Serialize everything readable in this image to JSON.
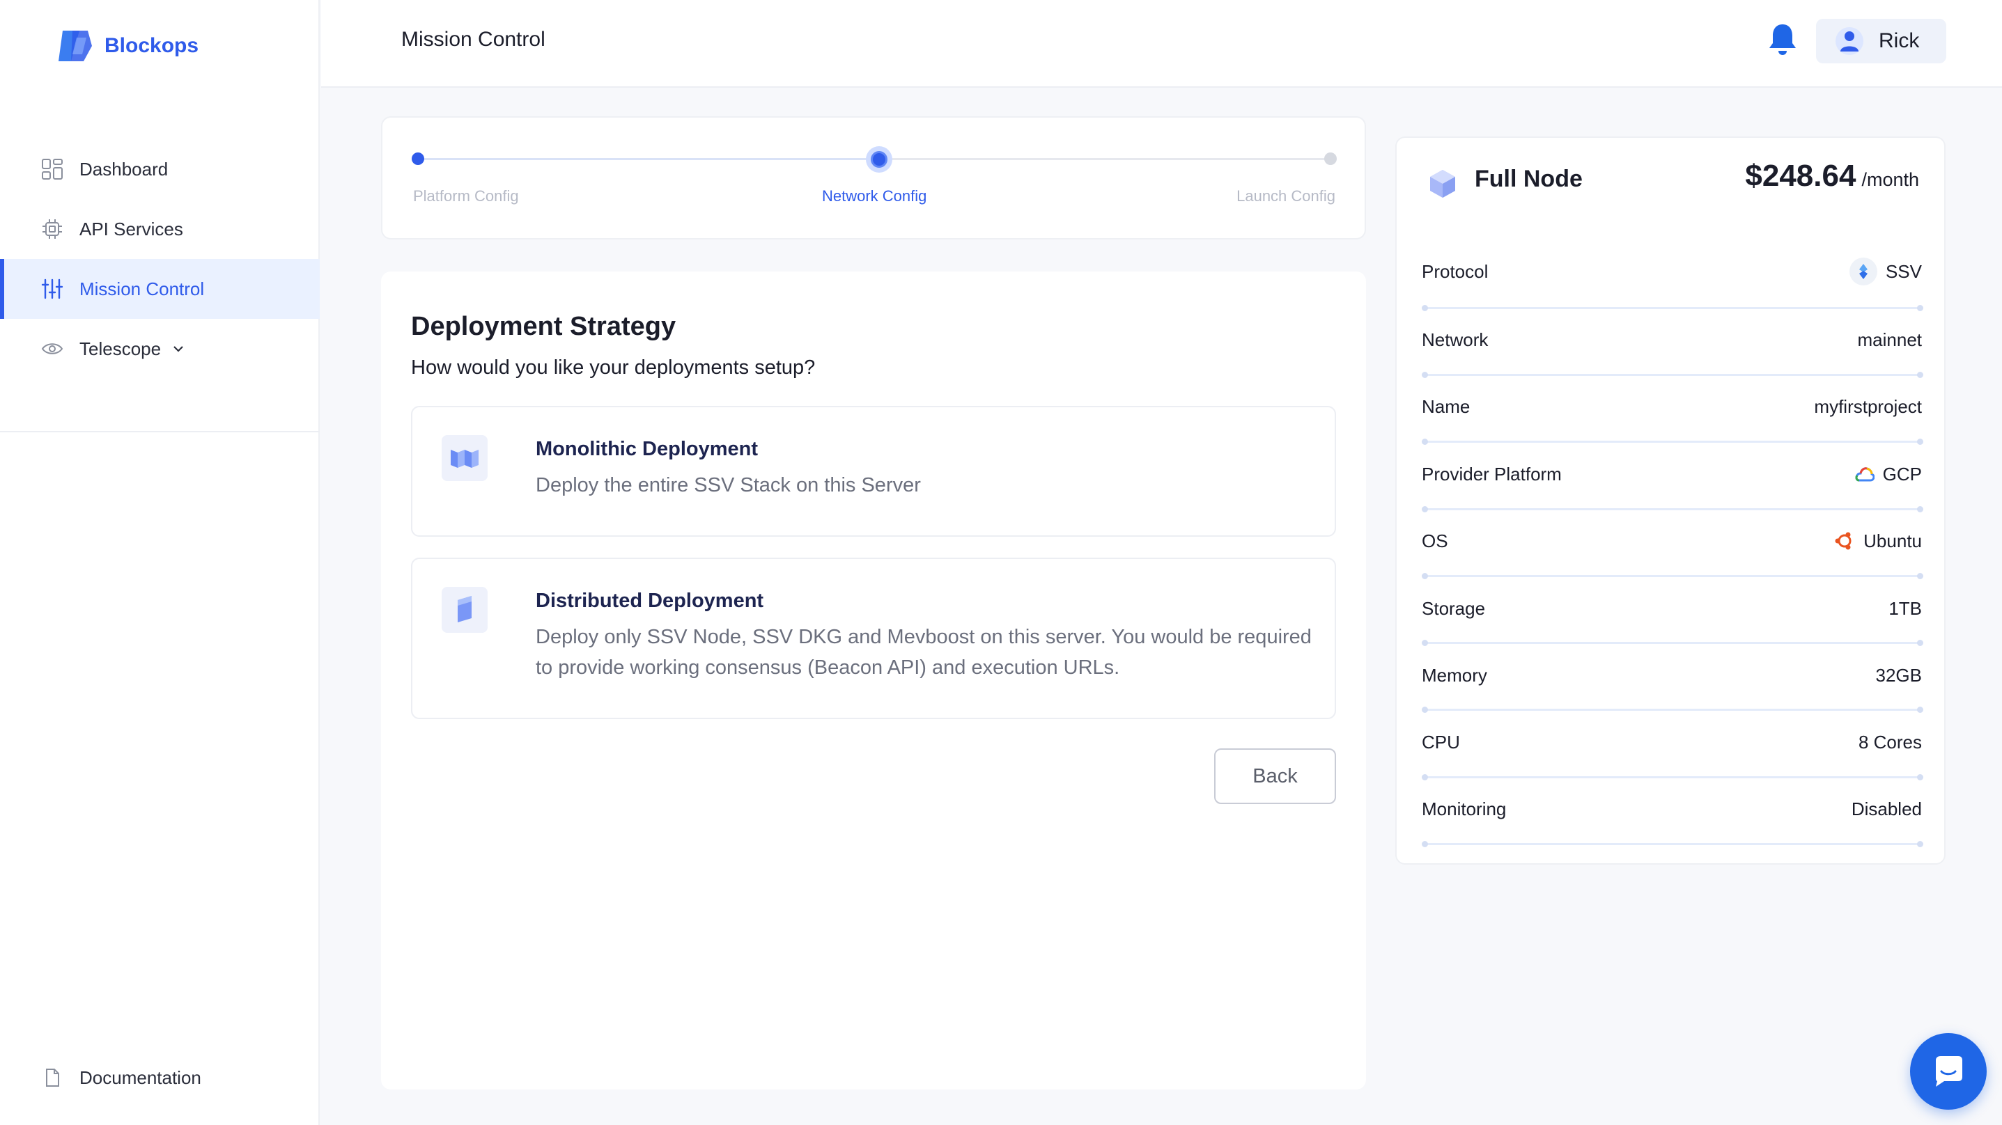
{
  "app": {
    "name": "Blockops"
  },
  "sidebar": {
    "items": [
      {
        "label": "Dashboard",
        "icon": "dashboard-icon"
      },
      {
        "label": "API Services",
        "icon": "chip-icon"
      },
      {
        "label": "Mission Control",
        "icon": "sliders-icon",
        "active": true
      },
      {
        "label": "Telescope",
        "icon": "eye-icon"
      }
    ],
    "footer": {
      "label": "Documentation",
      "icon": "document-icon"
    }
  },
  "header": {
    "title": "Mission Control",
    "user": "Rick"
  },
  "stepper": {
    "steps": [
      {
        "label": "Platform Config",
        "state": "done"
      },
      {
        "label": "Network Config",
        "state": "current"
      },
      {
        "label": "Launch Config",
        "state": "pending"
      }
    ]
  },
  "strategy": {
    "title": "Deployment Strategy",
    "subtitle": "How would you like your deployments setup?",
    "options": [
      {
        "title": "Monolithic Deployment",
        "description": "Deploy the entire SSV Stack on this Server",
        "icon": "monolithic-icon"
      },
      {
        "title": "Distributed Deployment",
        "description": "Deploy only SSV Node, SSV DKG and Mevboost on this server. You would be required to provide working consensus (Beacon API) and execution URLs.",
        "icon": "distributed-icon"
      }
    ],
    "back_label": "Back"
  },
  "summary": {
    "title": "Full Node",
    "price": "$248.64",
    "price_unit": "/month",
    "specs": [
      {
        "key": "Protocol",
        "value": "SSV",
        "icon": "ssv-icon"
      },
      {
        "key": "Network",
        "value": "mainnet"
      },
      {
        "key": "Name",
        "value": "myfirstproject"
      },
      {
        "key": "Provider Platform",
        "value": "GCP",
        "icon": "gcp-icon"
      },
      {
        "key": "OS",
        "value": "Ubuntu",
        "icon": "ubuntu-icon"
      },
      {
        "key": "Storage",
        "value": "1TB"
      },
      {
        "key": "Memory",
        "value": "32GB"
      },
      {
        "key": "CPU",
        "value": "8 Cores"
      },
      {
        "key": "Monitoring",
        "value": "Disabled"
      }
    ]
  },
  "colors": {
    "accent": "#2f5bea",
    "active_bg": "#eaf1ff",
    "chat": "#1f66e6"
  }
}
